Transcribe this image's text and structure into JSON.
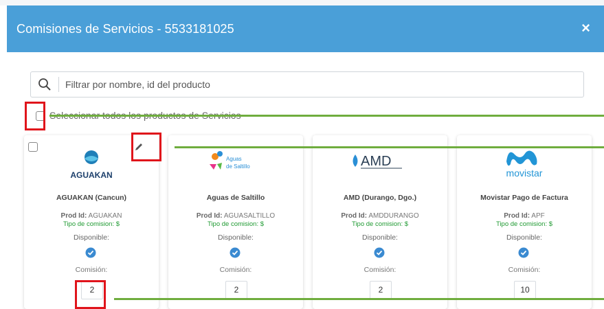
{
  "modal": {
    "title": "Comisiones de Servicios - 5533181025",
    "close_symbol": "×"
  },
  "search": {
    "placeholder": "Filtrar por nombre, id del producto"
  },
  "select_all_label": "Seleccionar todos los productos de Servicios",
  "field_labels": {
    "prod_id": "Prod Id:",
    "tipo_comision": "Tipo de comision: $",
    "disponible": "Disponible:",
    "comision": "Comisión:"
  },
  "products": [
    {
      "name": "AGUAKAN (Cancun)",
      "prod_id": "AGUAKAN",
      "comision": "2",
      "logo": "aguakan-logo",
      "logo_text": "AGUAKAN"
    },
    {
      "name": "Aguas de Saltillo",
      "prod_id": "AGUASALTILLO",
      "comision": "2",
      "logo": "aguas-saltillo-logo",
      "logo_text": "Aguas de Saltillo"
    },
    {
      "name": "AMD (Durango, Dgo.)",
      "prod_id": "AMDDURANGO",
      "comision": "2",
      "logo": "amd-logo",
      "logo_text": "AMD"
    },
    {
      "name": "Movistar Pago de Factura",
      "prod_id": "APF",
      "comision": "10",
      "logo": "movistar-logo",
      "logo_text": "movistar"
    }
  ],
  "colors": {
    "header": "#4a9fd8",
    "highlight_box": "#e0141b",
    "annotation_line": "#6fad3e",
    "tipo_text": "#1f9a32",
    "check_icon": "#3a8ad1"
  }
}
